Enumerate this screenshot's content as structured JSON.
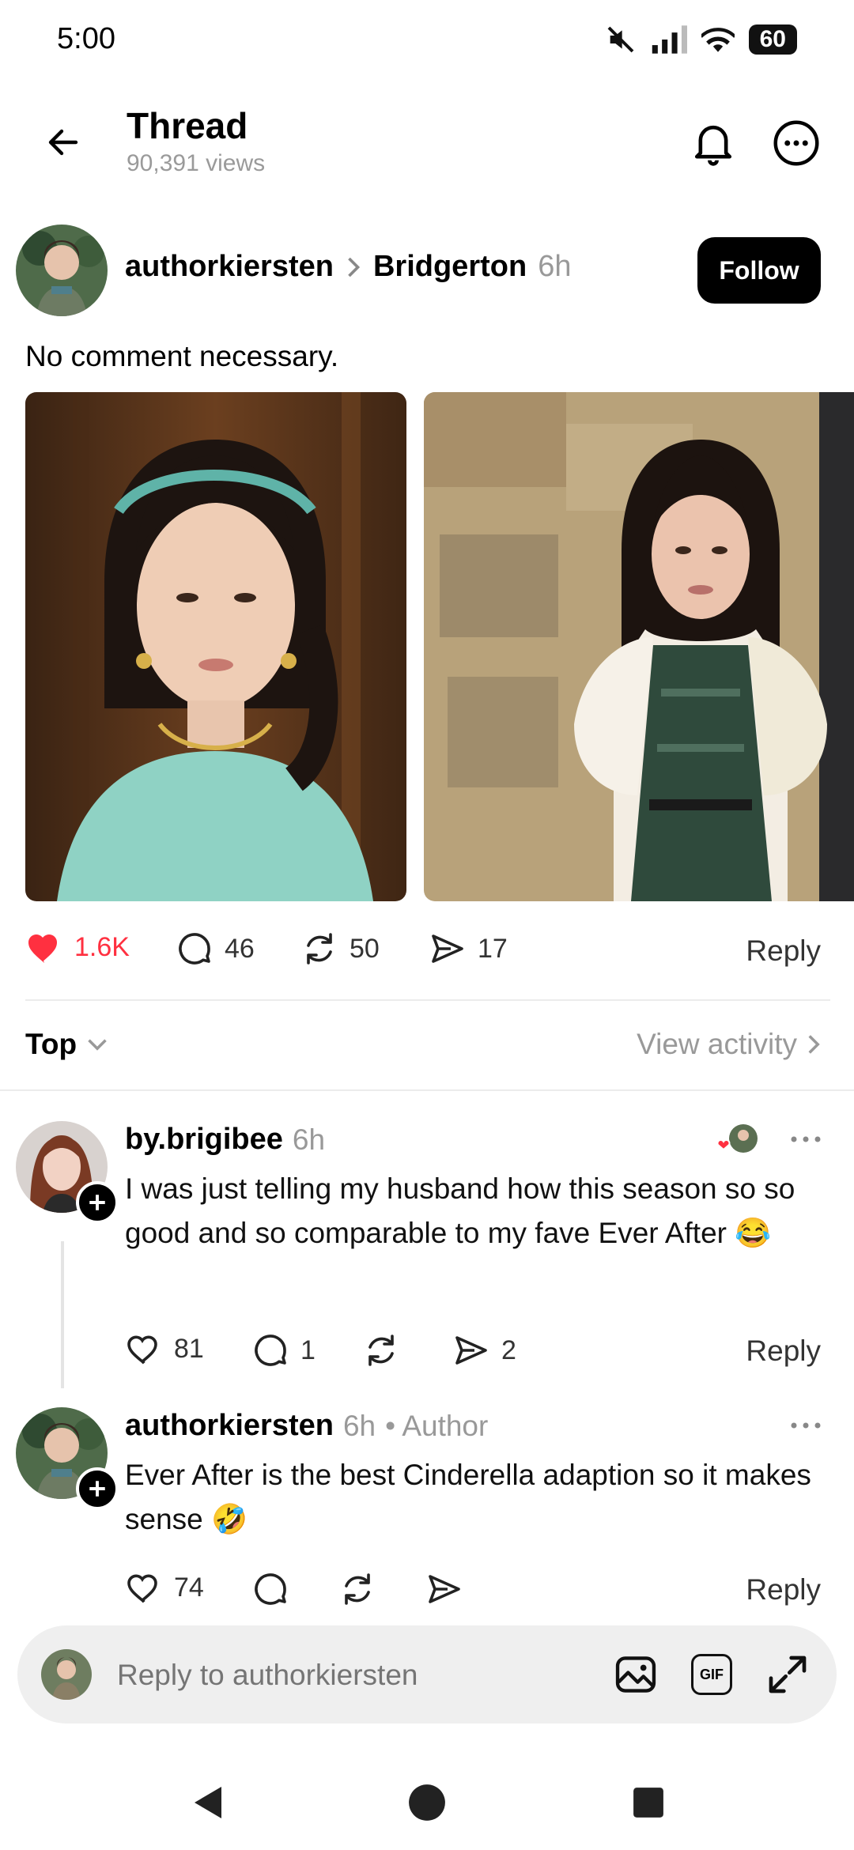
{
  "status_bar": {
    "time": "5:00",
    "battery": "60"
  },
  "header": {
    "title": "Thread",
    "views": "90,391 views"
  },
  "post": {
    "username": "authorkiersten",
    "community": "Bridgerton",
    "time": "6h",
    "follow_label": "Follow",
    "text": "No comment necessary.",
    "likes": "1.6K",
    "comments": "46",
    "reposts": "50",
    "shares": "17",
    "reply_label": "Reply"
  },
  "sort": {
    "label": "Top",
    "view_activity": "View activity"
  },
  "comments": [
    {
      "username": "by.brigibee",
      "time": "6h",
      "text": "I was just telling my husband how this season so so good and so comparable to my fave Ever After 😂",
      "likes": "81",
      "comments": "1",
      "shares": "2",
      "reply_label": "Reply"
    },
    {
      "username": "authorkiersten",
      "time": "6h",
      "author_tag": "• Author",
      "text": "Ever After is the best Cinderella adaption so it makes sense 🤣",
      "likes": "74",
      "reply_label": "Reply"
    }
  ],
  "composer": {
    "placeholder": "Reply to authorkiersten",
    "gif_label": "GIF"
  },
  "colors": {
    "like_red": "#ff3040",
    "follow_bg": "#000000",
    "muted": "#999999"
  },
  "icons": [
    "back-arrow-icon",
    "bell-icon",
    "more-icon",
    "chevron-right-icon",
    "heart-icon",
    "comment-icon",
    "repost-icon",
    "share-icon",
    "chevron-down-icon",
    "plus-icon",
    "image-icon",
    "gif-icon",
    "expand-icon",
    "nav-back-icon",
    "nav-home-icon",
    "nav-recents-icon"
  ]
}
